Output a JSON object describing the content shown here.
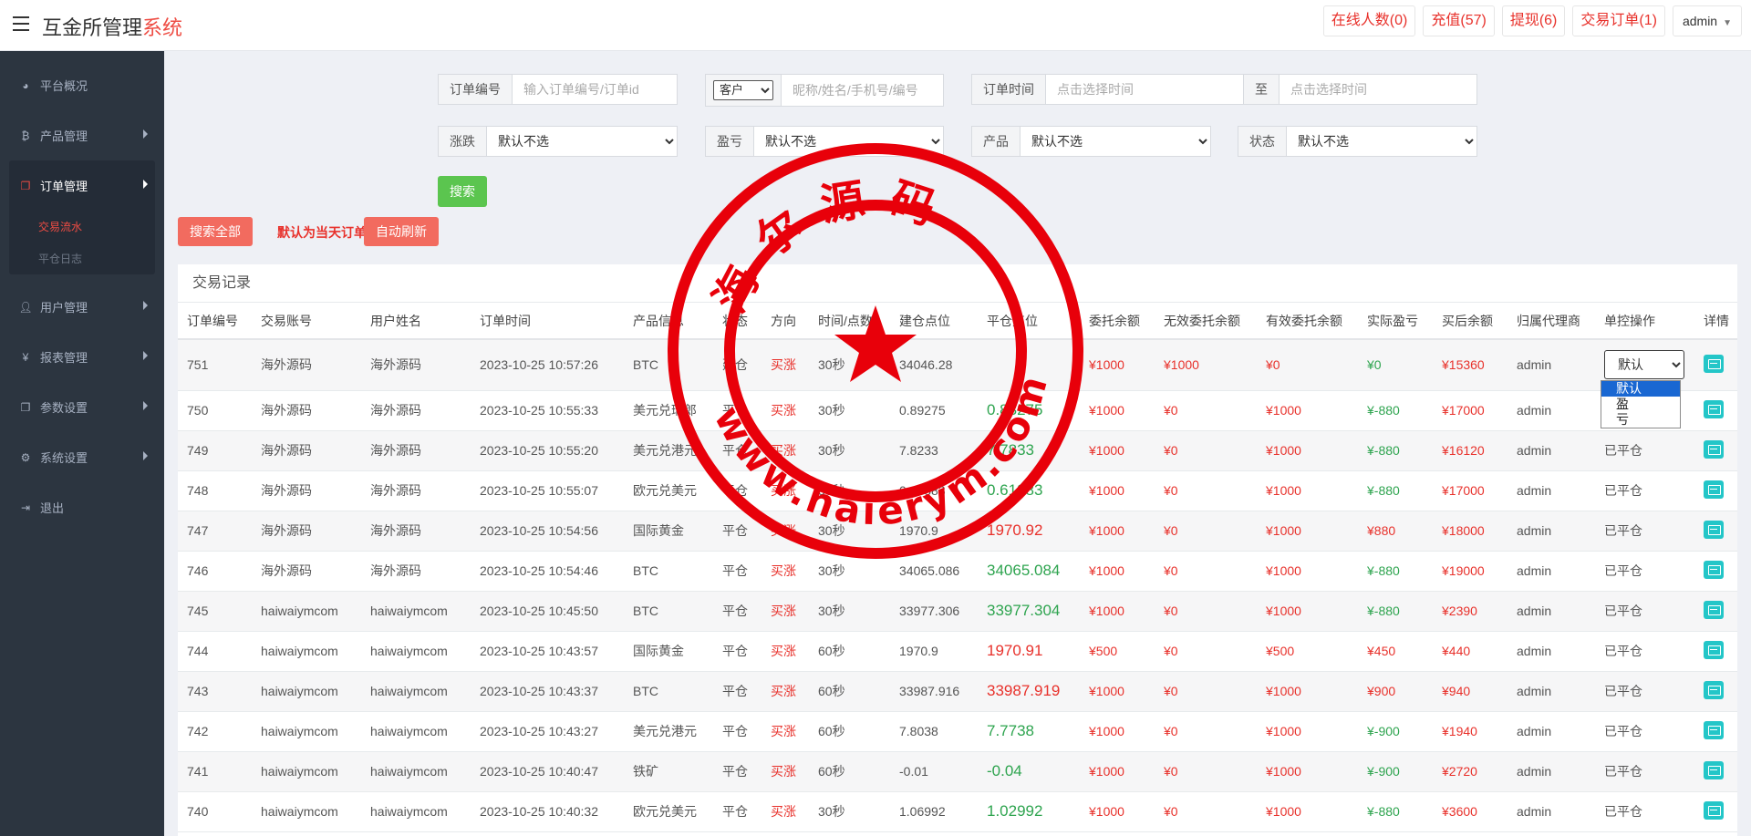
{
  "header": {
    "brand_main": "互金所管理",
    "brand_accent": "系统",
    "buttons": [
      {
        "label": "在线人数(0)"
      },
      {
        "label": "充值(57)"
      },
      {
        "label": "提现(6)"
      },
      {
        "label": "交易订单(1)"
      }
    ],
    "user_label": "admin"
  },
  "sidebar": {
    "items": [
      {
        "label": "平台概况",
        "icon": "dashboard-icon"
      },
      {
        "label": "产品管理",
        "icon": "bitcoin-icon"
      },
      {
        "label": "订单管理",
        "icon": "copy-icon"
      },
      {
        "label": "用户管理",
        "icon": "user-icon"
      },
      {
        "label": "报表管理",
        "icon": "yen-icon"
      },
      {
        "label": "参数设置",
        "icon": "copy-icon"
      },
      {
        "label": "系统设置",
        "icon": "gears-icon"
      },
      {
        "label": "退出",
        "icon": "signout-icon"
      }
    ],
    "order_sub": [
      {
        "label": "交易流水"
      },
      {
        "label": "平仓日志"
      }
    ]
  },
  "filters": {
    "order_no_label": "订单编号",
    "order_no_placeholder": "输入订单编号/订单id",
    "customer_select": "客户",
    "customer_placeholder": "昵称/姓名/手机号/编号",
    "order_time_label": "订单时间",
    "time_start_placeholder": "点击选择时间",
    "time_to": "至",
    "time_end_placeholder": "点击选择时间",
    "rise_fall_label": "涨跌",
    "profit_loss_label": "盈亏",
    "product_label": "产品",
    "status_label": "状态",
    "default_option": "默认不选",
    "search_button": "搜索"
  },
  "actions": {
    "search_all": "搜索全部",
    "hint": "默认为当天订单",
    "auto_refresh": "自动刷新"
  },
  "table": {
    "title": "交易记录",
    "columns": [
      "订单编号",
      "交易账号",
      "用户姓名",
      "订单时间",
      "产品信息",
      "状态",
      "方向",
      "时间/点数",
      "建仓点位",
      "平仓点位",
      "委托余额",
      "无效委托余额",
      "有效委托余额",
      "实际盈亏",
      "买后余额",
      "归属代理商",
      "单控操作",
      "详情"
    ],
    "rows": [
      {
        "id": "751",
        "account": "海外源码",
        "name": "海外源码",
        "time": "2023-10-25 10:57:26",
        "product": "BTC",
        "status": "建仓",
        "dir": "买涨",
        "period": "30秒",
        "open": "34046.28",
        "close": "",
        "close_color": "",
        "entrust": "¥1000",
        "invalid": "¥1000",
        "valid": "¥0",
        "pnl": "¥0",
        "pnl_color": "green",
        "after": "¥15360",
        "agent": "admin",
        "op": "默认"
      },
      {
        "id": "750",
        "account": "海外源码",
        "name": "海外源码",
        "time": "2023-10-25 10:55:33",
        "product": "美元兑瑞郎",
        "status": "平仓",
        "dir": "买涨",
        "period": "30秒",
        "open": "0.89275",
        "close": "0.88275",
        "close_color": "green",
        "entrust": "¥1000",
        "invalid": "¥0",
        "valid": "¥1000",
        "pnl": "¥-880",
        "pnl_color": "green",
        "after": "¥17000",
        "agent": "admin",
        "op": "已平仓"
      },
      {
        "id": "749",
        "account": "海外源码",
        "name": "海外源码",
        "time": "2023-10-25 10:55:20",
        "product": "美元兑港元",
        "status": "平仓",
        "dir": "买涨",
        "period": "30秒",
        "open": "7.8233",
        "close": "7.7833",
        "close_color": "green",
        "entrust": "¥1000",
        "invalid": "¥0",
        "valid": "¥1000",
        "pnl": "¥-880",
        "pnl_color": "green",
        "after": "¥16120",
        "agent": "admin",
        "op": "已平仓"
      },
      {
        "id": "748",
        "account": "海外源码",
        "name": "海外源码",
        "time": "2023-10-25 10:55:07",
        "product": "欧元兑美元",
        "status": "平仓",
        "dir": "买涨",
        "period": "30秒",
        "open": "0.63883",
        "close": "0.61883",
        "close_color": "green",
        "entrust": "¥1000",
        "invalid": "¥0",
        "valid": "¥1000",
        "pnl": "¥-880",
        "pnl_color": "green",
        "after": "¥17000",
        "agent": "admin",
        "op": "已平仓"
      },
      {
        "id": "747",
        "account": "海外源码",
        "name": "海外源码",
        "time": "2023-10-25 10:54:56",
        "product": "国际黄金",
        "status": "平仓",
        "dir": "买涨",
        "period": "30秒",
        "open": "1970.9",
        "close": "1970.92",
        "close_color": "red",
        "entrust": "¥1000",
        "invalid": "¥0",
        "valid": "¥1000",
        "pnl": "¥880",
        "pnl_color": "red",
        "after": "¥18000",
        "agent": "admin",
        "op": "已平仓"
      },
      {
        "id": "746",
        "account": "海外源码",
        "name": "海外源码",
        "time": "2023-10-25 10:54:46",
        "product": "BTC",
        "status": "平仓",
        "dir": "买涨",
        "period": "30秒",
        "open": "34065.086",
        "close": "34065.084",
        "close_color": "green",
        "entrust": "¥1000",
        "invalid": "¥0",
        "valid": "¥1000",
        "pnl": "¥-880",
        "pnl_color": "green",
        "after": "¥19000",
        "agent": "admin",
        "op": "已平仓"
      },
      {
        "id": "745",
        "account": "haiwaiymcom",
        "name": "haiwaiymcom",
        "time": "2023-10-25 10:45:50",
        "product": "BTC",
        "status": "平仓",
        "dir": "买涨",
        "period": "30秒",
        "open": "33977.306",
        "close": "33977.304",
        "close_color": "green",
        "entrust": "¥1000",
        "invalid": "¥0",
        "valid": "¥1000",
        "pnl": "¥-880",
        "pnl_color": "green",
        "after": "¥2390",
        "agent": "admin",
        "op": "已平仓"
      },
      {
        "id": "744",
        "account": "haiwaiymcom",
        "name": "haiwaiymcom",
        "time": "2023-10-25 10:43:57",
        "product": "国际黄金",
        "status": "平仓",
        "dir": "买涨",
        "period": "60秒",
        "open": "1970.9",
        "close": "1970.91",
        "close_color": "red",
        "entrust": "¥500",
        "invalid": "¥0",
        "valid": "¥500",
        "pnl": "¥450",
        "pnl_color": "red",
        "after": "¥440",
        "agent": "admin",
        "op": "已平仓"
      },
      {
        "id": "743",
        "account": "haiwaiymcom",
        "name": "haiwaiymcom",
        "time": "2023-10-25 10:43:37",
        "product": "BTC",
        "status": "平仓",
        "dir": "买涨",
        "period": "60秒",
        "open": "33987.916",
        "close": "33987.919",
        "close_color": "red",
        "entrust": "¥1000",
        "invalid": "¥0",
        "valid": "¥1000",
        "pnl": "¥900",
        "pnl_color": "red",
        "after": "¥940",
        "agent": "admin",
        "op": "已平仓"
      },
      {
        "id": "742",
        "account": "haiwaiymcom",
        "name": "haiwaiymcom",
        "time": "2023-10-25 10:43:27",
        "product": "美元兑港元",
        "status": "平仓",
        "dir": "买涨",
        "period": "60秒",
        "open": "7.8038",
        "close": "7.7738",
        "close_color": "green",
        "entrust": "¥1000",
        "invalid": "¥0",
        "valid": "¥1000",
        "pnl": "¥-900",
        "pnl_color": "green",
        "after": "¥1940",
        "agent": "admin",
        "op": "已平仓"
      },
      {
        "id": "741",
        "account": "haiwaiymcom",
        "name": "haiwaiymcom",
        "time": "2023-10-25 10:40:47",
        "product": "铁矿",
        "status": "平仓",
        "dir": "买涨",
        "period": "60秒",
        "open": "-0.01",
        "close": "-0.04",
        "close_color": "green",
        "entrust": "¥1000",
        "invalid": "¥0",
        "valid": "¥1000",
        "pnl": "¥-900",
        "pnl_color": "green",
        "after": "¥2720",
        "agent": "admin",
        "op": "已平仓"
      },
      {
        "id": "740",
        "account": "haiwaiymcom",
        "name": "haiwaiymcom",
        "time": "2023-10-25 10:40:32",
        "product": "欧元兑美元",
        "status": "平仓",
        "dir": "买涨",
        "period": "30秒",
        "open": "1.06992",
        "close": "1.02992",
        "close_color": "green",
        "entrust": "¥1000",
        "invalid": "¥0",
        "valid": "¥1000",
        "pnl": "¥-880",
        "pnl_color": "green",
        "after": "¥3600",
        "agent": "admin",
        "op": "已平仓"
      }
    ],
    "op_options": [
      "默认",
      "盈",
      "亏"
    ]
  },
  "watermark": {
    "top_text": "海尔源码",
    "bottom_text": "www.haierym.com"
  },
  "colors": {
    "accent_red": "#e8312b",
    "profit_green": "#2ea44f",
    "sidebar_bg": "#2c3540",
    "search_green": "#5bc54f",
    "detail_teal": "#23c6c8"
  }
}
